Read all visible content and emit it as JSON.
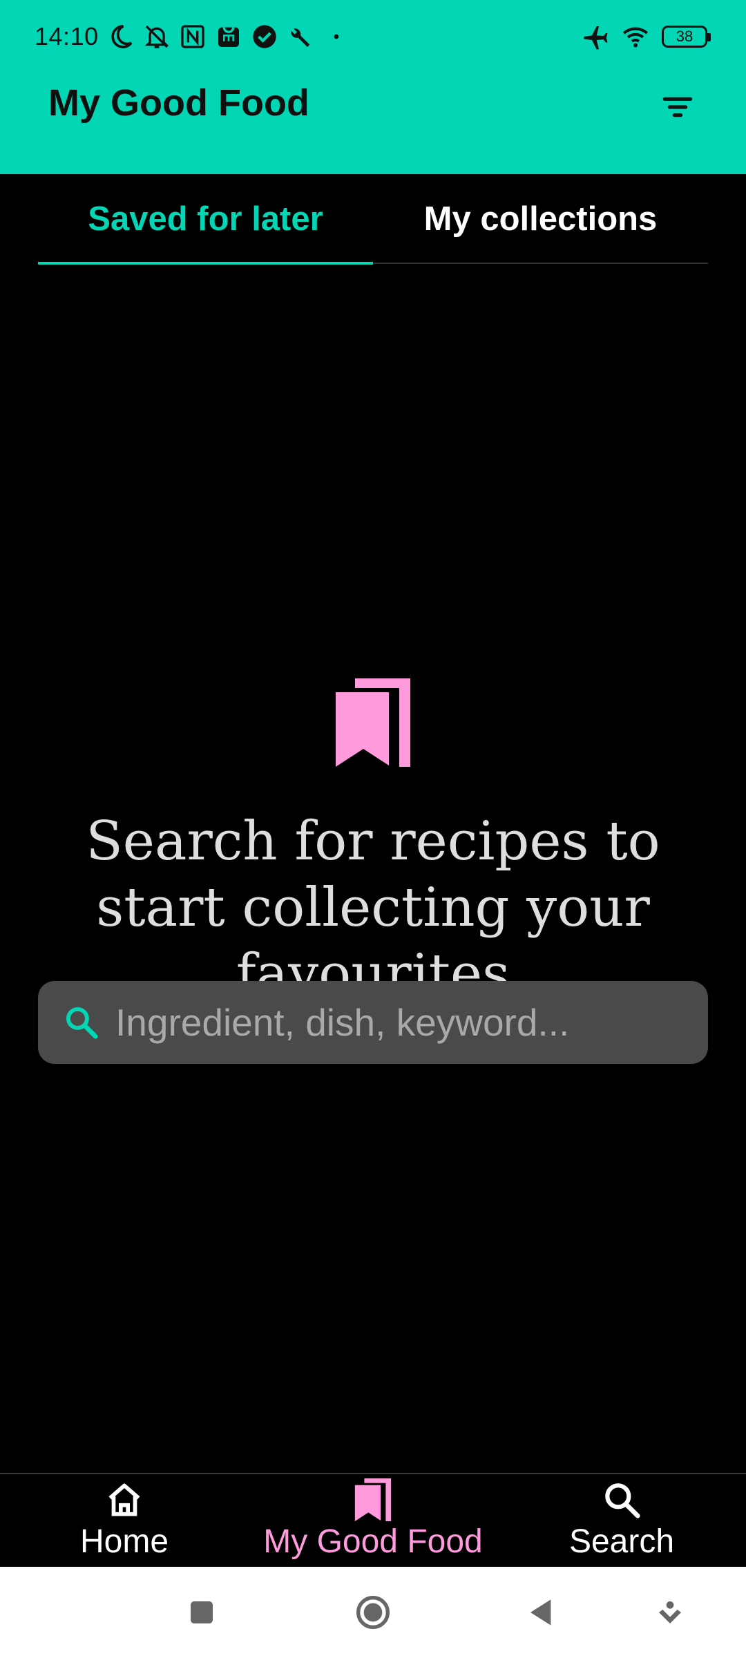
{
  "status_bar": {
    "time": "14:10",
    "battery": "38",
    "left_icons": [
      "moon-icon",
      "bell-off-icon",
      "nfc-icon",
      "mi-store-icon",
      "check-circle-icon",
      "wrench-icon",
      "dot-icon"
    ],
    "right_icons": [
      "airplane-icon",
      "wifi-icon",
      "battery-icon"
    ]
  },
  "header": {
    "title": "My Good Food",
    "filter_icon": "filter-icon",
    "background": "#02D6B4"
  },
  "tabs": [
    {
      "label": "Saved for later",
      "active": true
    },
    {
      "label": "My collections",
      "active": false
    }
  ],
  "empty_state": {
    "icon": "bookmarks-icon",
    "icon_color": "#FF9BDC",
    "message": "Search for recipes to start collecting your favourites"
  },
  "search": {
    "placeholder": "Ingredient, dish, keyword...",
    "value": "",
    "icon": "search-icon"
  },
  "bottom_nav": [
    {
      "label": "Home",
      "icon": "home-icon",
      "active": false
    },
    {
      "label": "My Good Food",
      "icon": "bookmarks-icon",
      "active": true
    },
    {
      "label": "Search",
      "icon": "search-icon",
      "active": false
    }
  ],
  "system_nav": [
    "recents-icon",
    "home-circle-icon",
    "back-icon",
    "menu-down-icon"
  ],
  "colors": {
    "accent": "#02D6B4",
    "pink": "#FF9BDC",
    "background": "#000000",
    "search_bg": "#4A4A4A"
  }
}
